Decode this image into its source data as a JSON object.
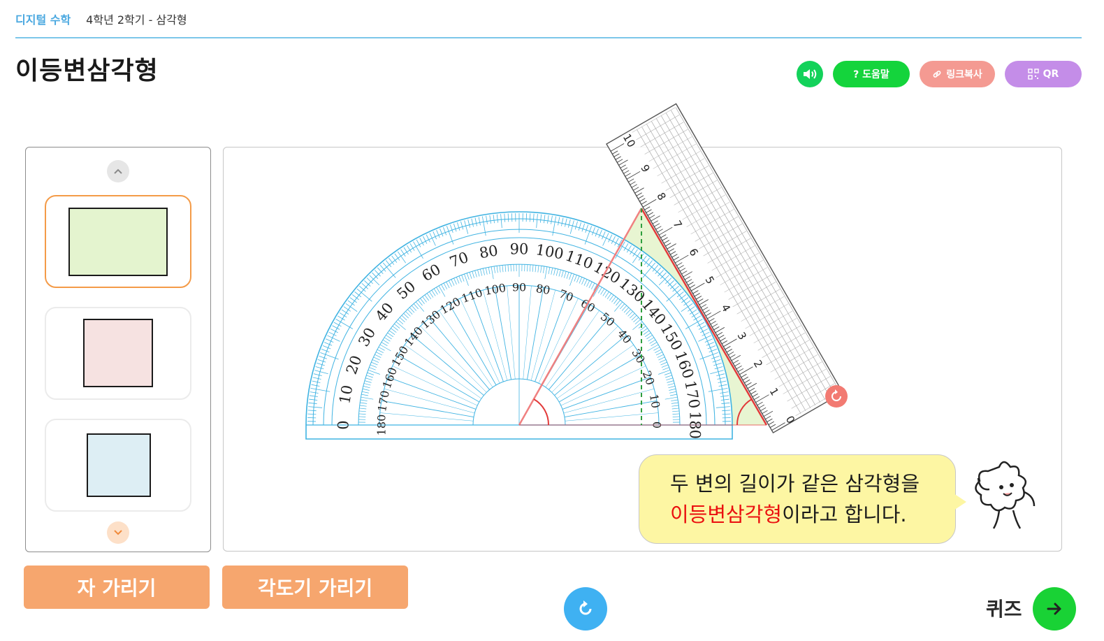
{
  "breadcrumb": {
    "subject": "디지털 수학",
    "unit": "4학년 2학기 - 삼각형"
  },
  "page_title": "이등변삼각형",
  "toolbar": {
    "help_label": "? 도움말",
    "link_label": "링크복사",
    "qr_label": "QR"
  },
  "sidebar": {
    "selected_index": 0,
    "items": [
      {
        "name": "shape-card-1",
        "fill": "#e4f4cf"
      },
      {
        "name": "shape-card-2",
        "fill": "#f6e2e1"
      },
      {
        "name": "shape-card-3",
        "fill": "#ddeef4"
      }
    ]
  },
  "protractor": {
    "outer_scale": [
      "0",
      "10",
      "20",
      "30",
      "40",
      "50",
      "60",
      "70",
      "80",
      "90",
      "100",
      "110",
      "120",
      "130",
      "140",
      "150",
      "160",
      "170",
      "180"
    ],
    "inner_scale": [
      "180",
      "170",
      "160",
      "150",
      "140",
      "130",
      "120",
      "110",
      "100",
      "90",
      "80",
      "70",
      "60",
      "50",
      "40",
      "30",
      "20",
      "10",
      "0"
    ]
  },
  "ruler": {
    "labels": [
      "0",
      "1",
      "2",
      "3",
      "4",
      "5",
      "6",
      "7",
      "8",
      "9",
      "10"
    ]
  },
  "speech": {
    "line1": "두 변의 길이가 같은 삼각형을",
    "highlight": "이등변삼각형",
    "rest": "이라고 합니다."
  },
  "buttons": {
    "hide_ruler": "자 가리기",
    "hide_protractor": "각도기 가리기",
    "quiz": "퀴즈"
  },
  "colors": {
    "protractor": "#3fb3e2",
    "triangle": "#e23a3a",
    "triangle_fill": "#e8f5d2",
    "accent_orange": "#f6a66e"
  }
}
